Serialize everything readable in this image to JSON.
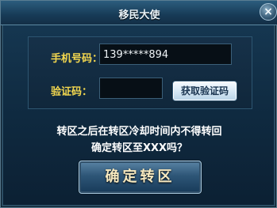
{
  "dialog": {
    "title": "移民大使",
    "close_label": "×"
  },
  "form": {
    "phone_label": "手机号码：",
    "phone_value": "139*****894",
    "code_label": "验证码：",
    "code_value": "",
    "get_code_label": "获取验证码"
  },
  "message": {
    "line1": "转区之后在转区冷却时间内不得转回",
    "line2": "确定转区至XXX吗？"
  },
  "actions": {
    "confirm_label": "确定转区"
  }
}
